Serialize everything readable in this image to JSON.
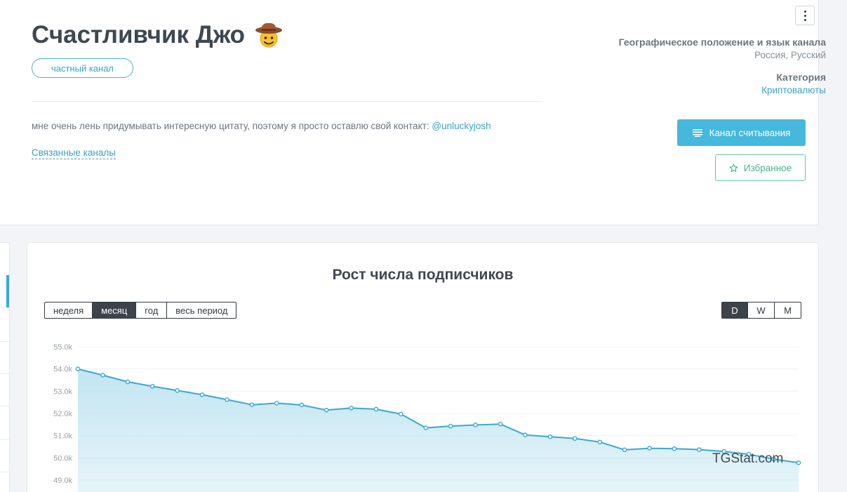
{
  "channel": {
    "title": "Счастливчик Джо",
    "badge": "частный канал",
    "description": "мне очень лень придумывать интересную цитату, поэтому я просто оставлю свой контакт:",
    "contact": "@unluckyjosh",
    "related_label": "Связанные каналы"
  },
  "meta": {
    "geo_label": "Географическое положение и язык канала",
    "geo_value": "Россия, Русский",
    "category_label": "Категория",
    "category_value": "Криптовалюты"
  },
  "actions": {
    "read_label": "Канал считывания",
    "favorite_label": "Избранное"
  },
  "colors": {
    "accent": "#45b8dc",
    "favorite": "#5fc7a6",
    "line": "#3aa9cf",
    "area": "#bfe4f1"
  },
  "chart_section": {
    "title": "Рост числа подписчиков",
    "periods": [
      "неделя",
      "месяц",
      "год",
      "весь период"
    ],
    "active_period": "месяц",
    "granularity": [
      "D",
      "W",
      "M"
    ],
    "active_granularity": "D",
    "watermark": "TGStat.com"
  },
  "chart_data": {
    "type": "area",
    "title": "",
    "xlabel": "",
    "ylabel": "",
    "ylim": [
      49000,
      55000
    ],
    "yticks": [
      "55.0k",
      "54.0k",
      "53.0k",
      "52.0k",
      "51.0k",
      "50.0k",
      "49.0k"
    ],
    "grid": true,
    "legend": "none",
    "series": [
      {
        "values": [
          54000,
          53720,
          53420,
          53220,
          53030,
          52840,
          52620,
          52390,
          52460,
          52380,
          52150,
          52240,
          52190,
          51970,
          51350,
          51430,
          51480,
          51520,
          51030,
          50950,
          50870,
          50710,
          50360,
          50430,
          50410,
          50370,
          50290,
          50160,
          49940,
          49780
        ]
      }
    ]
  }
}
